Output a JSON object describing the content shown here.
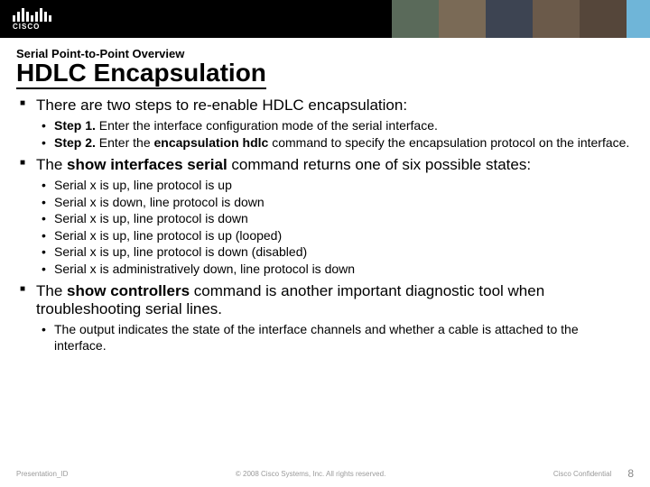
{
  "logo_text": "CISCO",
  "pretitle": "Serial Point-to-Point Overview",
  "title": "HDLC Encapsulation",
  "bullet1_lead": "There are two steps to re-enable HDLC encapsulation:",
  "step1_label": "Step 1.",
  "step1_text": " Enter the interface configuration mode of the serial interface.",
  "step2_label": "Step 2.",
  "step2_text_a": " Enter the ",
  "step2_cmd": "encapsulation hdlc",
  "step2_text_b": " command to specify the encapsulation protocol on the interface.",
  "bullet2_a": "The ",
  "bullet2_cmd": "show interfaces serial",
  "bullet2_b": " command returns one of six possible states:",
  "states": [
    "Serial x is up, line protocol is up",
    "Serial x is down, line protocol is down",
    "Serial x is up, line protocol is down",
    "Serial x is up, line protocol is up (looped)",
    "Serial x is up, line protocol is down (disabled)",
    "Serial x is administratively down, line protocol is down"
  ],
  "bullet3_a": "The ",
  "bullet3_cmd": "show controllers",
  "bullet3_b": " command is another important diagnostic tool when troubleshooting serial lines.",
  "bullet3_sub": "The output indicates the state of the interface channels and whether a cable is attached to the interface.",
  "footer": {
    "pid": "Presentation_ID",
    "copyright": "© 2008 Cisco Systems, Inc. All rights reserved.",
    "confidential": "Cisco Confidential",
    "page": "8"
  }
}
